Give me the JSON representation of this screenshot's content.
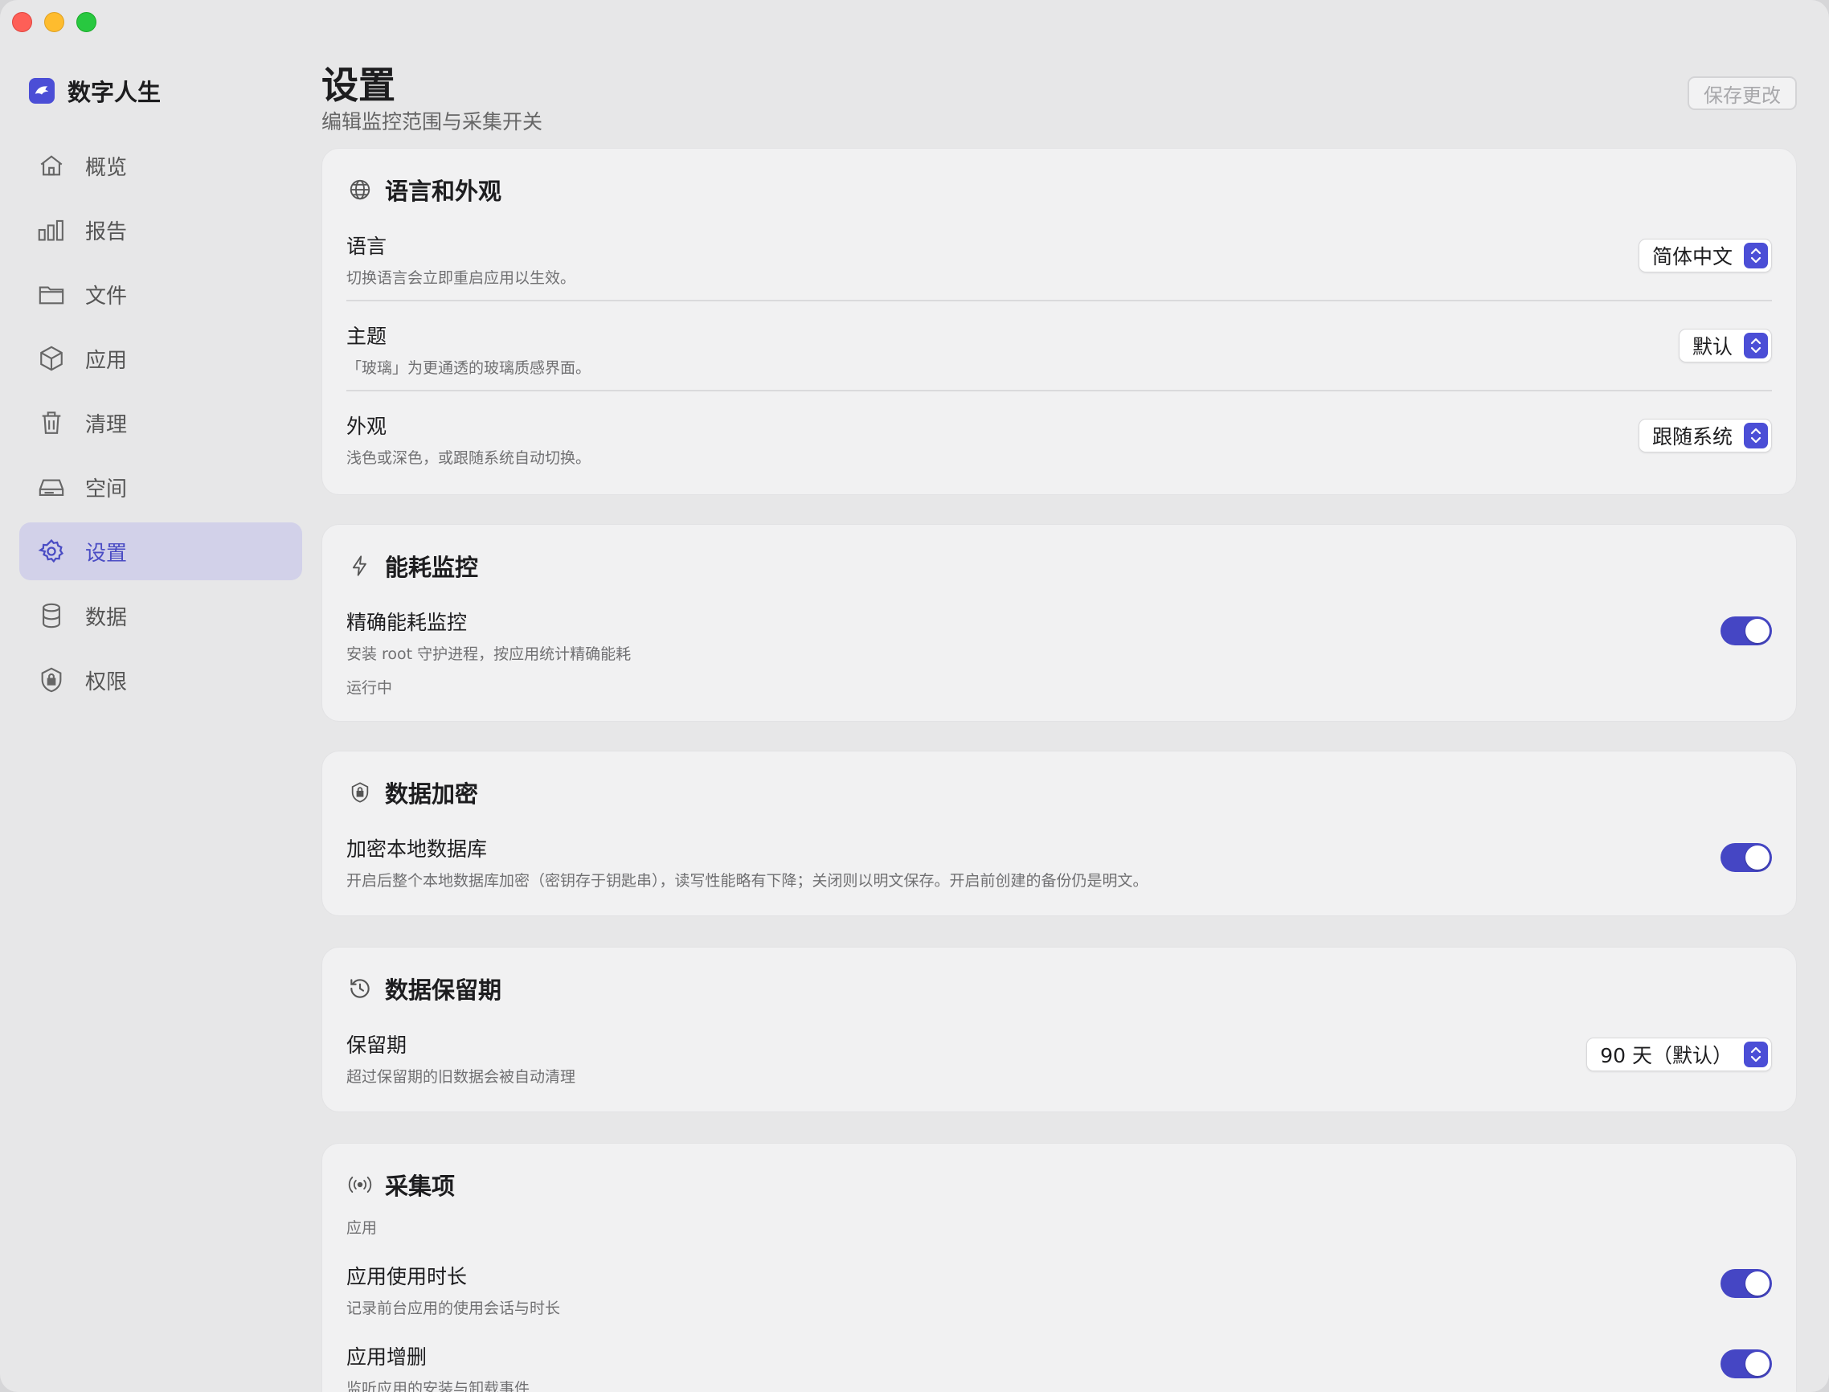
{
  "app": {
    "name": "数字人生"
  },
  "sidebar": {
    "items": [
      {
        "label": "概览",
        "icon": "home-icon"
      },
      {
        "label": "报告",
        "icon": "bar-chart-icon"
      },
      {
        "label": "文件",
        "icon": "folder-icon"
      },
      {
        "label": "应用",
        "icon": "package-icon"
      },
      {
        "label": "清理",
        "icon": "trash-icon"
      },
      {
        "label": "空间",
        "icon": "drive-icon"
      },
      {
        "label": "设置",
        "icon": "gear-icon",
        "active": true
      },
      {
        "label": "数据",
        "icon": "database-icon"
      },
      {
        "label": "权限",
        "icon": "shield-lock-icon"
      }
    ]
  },
  "header": {
    "title": "设置",
    "subtitle": "编辑监控范围与采集开关",
    "save_label": "保存更改"
  },
  "sections": {
    "appearance": {
      "title": "语言和外观",
      "icon": "globe-icon",
      "language": {
        "title": "语言",
        "desc": "切换语言会立即重启应用以生效。",
        "value": "简体中文"
      },
      "theme": {
        "title": "主题",
        "desc": "「玻璃」为更通透的玻璃质感界面。",
        "value": "默认"
      },
      "appearance": {
        "title": "外观",
        "desc": "浅色或深色，或跟随系统自动切换。",
        "value": "跟随系统"
      }
    },
    "energy": {
      "title": "能耗监控",
      "icon": "bolt-icon",
      "precise": {
        "title": "精确能耗监控",
        "desc": "安装 root 守护进程，按应用统计精确能耗",
        "enabled": true
      },
      "status": "运行中"
    },
    "encryption": {
      "title": "数据加密",
      "icon": "shield-lock-icon",
      "encrypt_db": {
        "title": "加密本地数据库",
        "desc": "开启后整个本地数据库加密（密钥存于钥匙串），读写性能略有下降；关闭则以明文保存。开启前创建的备份仍是明文。",
        "enabled": true
      }
    },
    "retention": {
      "title": "数据保留期",
      "icon": "history-icon",
      "period": {
        "title": "保留期",
        "desc": "超过保留期的旧数据会被自动清理",
        "value": "90 天（默认）"
      }
    },
    "collection": {
      "title": "采集项",
      "icon": "broadcast-icon",
      "group_label": "应用",
      "usage": {
        "title": "应用使用时长",
        "desc": "记录前台应用的使用会话与时长",
        "enabled": true
      },
      "install": {
        "title": "应用增删",
        "desc": "监听应用的安装与卸载事件",
        "enabled": true
      }
    }
  },
  "colors": {
    "accent": "#4b4ed6",
    "toggle_on": "#4546c4",
    "sidebar_active": "#d2d1e9"
  }
}
